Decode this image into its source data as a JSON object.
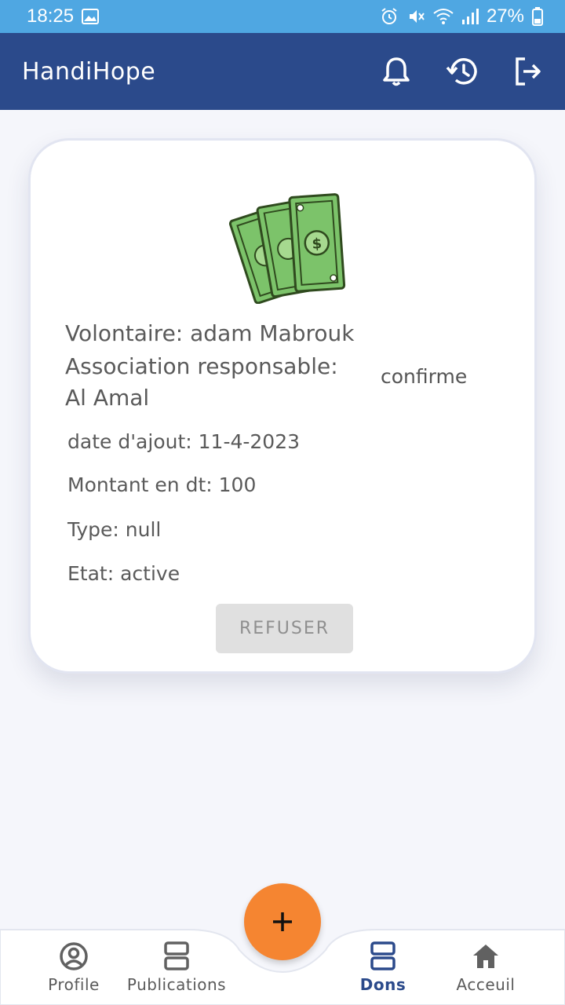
{
  "status_bar": {
    "time": "18:25",
    "battery": "27%"
  },
  "app_bar": {
    "title": "HandiHope"
  },
  "donation": {
    "volunteer": "Volontaire: adam Mabrouk",
    "association": "Association responsable: Al Amal",
    "status_label": "confirme",
    "date": "date d'ajout: 11-4-2023",
    "amount": "Montant en dt: 100",
    "type": "Type: null",
    "state": "Etat: active",
    "refuse_button": "REFUSER"
  },
  "bottom_nav": {
    "items": [
      {
        "label": "Profile",
        "icon": "account-circle-icon"
      },
      {
        "label": "Publications",
        "icon": "storage-icon"
      },
      {
        "label": "Dons",
        "icon": "storage-icon"
      },
      {
        "label": "Acceuil",
        "icon": "home-icon"
      }
    ],
    "active": "Dons",
    "fab_label": "+"
  },
  "colors": {
    "status_bar": "#4fa7e2",
    "app_bar": "#2b4a8b",
    "fab": "#f58531",
    "active_nav": "#2b4a8b"
  }
}
